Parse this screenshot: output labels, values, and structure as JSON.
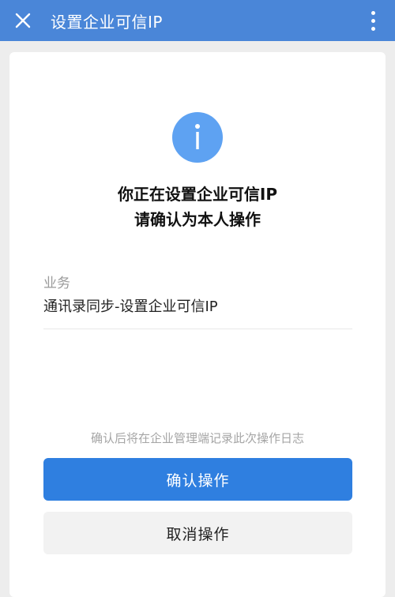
{
  "header": {
    "title": "设置企业可信IP",
    "close_icon": "close-icon",
    "more_icon": "more-vertical-icon",
    "background_color": "#4a86d8"
  },
  "main": {
    "icon": "info-icon",
    "icon_color": "#5ea2f2",
    "headline_line1": "你正在设置企业可信IP",
    "headline_line2": "请确认为本人操作",
    "field_label": "业务",
    "field_value": "通讯录同步-设置企业可信IP",
    "notice": "确认后将在企业管理端记录此次操作日志",
    "confirm_label": "确认操作",
    "cancel_label": "取消操作",
    "confirm_color": "#2f7fe0"
  }
}
